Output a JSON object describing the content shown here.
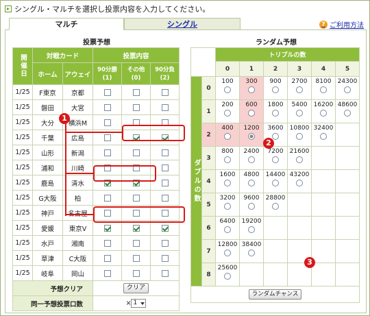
{
  "instruction": "シングル・マルチを選択し投票内容を入力してください。",
  "tabs": {
    "multi": "マルチ",
    "single": "シングル"
  },
  "help_link": "ご利用方法",
  "left": {
    "title": "投票予想",
    "headers": {
      "date": "開催日",
      "match": "対戦カード",
      "home": "ホーム",
      "away": "アウェイ",
      "vote": "投票内容",
      "o1": "90分勝",
      "o1b": "(1)",
      "o2": "その他",
      "o2b": "(0)",
      "o3": "90分負",
      "o3b": "(2)"
    },
    "rows": [
      {
        "date": "1/25",
        "home": "F東京",
        "away": "京都",
        "c": [
          false,
          false,
          false
        ]
      },
      {
        "date": "1/25",
        "home": "磐田",
        "away": "大宮",
        "c": [
          false,
          false,
          false
        ]
      },
      {
        "date": "1/25",
        "home": "大分",
        "away": "横浜M",
        "c": [
          false,
          false,
          false
        ]
      },
      {
        "date": "1/25",
        "home": "千葉",
        "away": "広島",
        "c": [
          false,
          true,
          true
        ]
      },
      {
        "date": "1/25",
        "home": "山形",
        "away": "新潟",
        "c": [
          false,
          false,
          false
        ]
      },
      {
        "date": "1/25",
        "home": "浦和",
        "away": "川崎",
        "c": [
          false,
          false,
          false
        ]
      },
      {
        "date": "1/25",
        "home": "鹿島",
        "away": "清水",
        "c": [
          true,
          true,
          false
        ]
      },
      {
        "date": "1/25",
        "home": "G大阪",
        "away": "柏",
        "c": [
          false,
          false,
          false
        ]
      },
      {
        "date": "1/25",
        "home": "神戸",
        "away": "名古屋",
        "c": [
          false,
          false,
          false
        ]
      },
      {
        "date": "1/25",
        "home": "愛媛",
        "away": "東京V",
        "c": [
          true,
          true,
          true
        ]
      },
      {
        "date": "1/25",
        "home": "水戸",
        "away": "湘南",
        "c": [
          false,
          false,
          false
        ]
      },
      {
        "date": "1/25",
        "home": "草津",
        "away": "C大阪",
        "c": [
          false,
          false,
          false
        ]
      },
      {
        "date": "1/25",
        "home": "岐阜",
        "away": "岡山",
        "c": [
          false,
          false,
          false
        ]
      }
    ],
    "clear_label": "予想クリア",
    "clear_button": "クリア",
    "multiplier_label": "同一予想投票口数",
    "multiplier_prefix": "×",
    "multiplier_value": "1"
  },
  "right": {
    "title": "ランダム予想",
    "triple_header": "トリプルの数",
    "double_header": "ダブルの数",
    "cols": [
      "0",
      "1",
      "2",
      "3",
      "4",
      "5"
    ],
    "rows": [
      {
        "label": "0",
        "cells": [
          "100",
          "300",
          "900",
          "2700",
          "8100",
          "24300"
        ]
      },
      {
        "label": "1",
        "cells": [
          "200",
          "600",
          "1800",
          "5400",
          "16200",
          "48600"
        ]
      },
      {
        "label": "2",
        "cells": [
          "400",
          "1200",
          "3600",
          "10800",
          "32400",
          ""
        ]
      },
      {
        "label": "3",
        "cells": [
          "800",
          "2400",
          "7200",
          "21600",
          "",
          ""
        ]
      },
      {
        "label": "4",
        "cells": [
          "1600",
          "4800",
          "14400",
          "43200",
          "",
          ""
        ]
      },
      {
        "label": "5",
        "cells": [
          "3200",
          "9600",
          "28800",
          "",
          "",
          ""
        ]
      },
      {
        "label": "6",
        "cells": [
          "6400",
          "19200",
          "",
          "",
          "",
          ""
        ]
      },
      {
        "label": "7",
        "cells": [
          "12800",
          "38400",
          "",
          "",
          "",
          ""
        ]
      },
      {
        "label": "8",
        "cells": [
          "25600",
          "",
          "",
          "",
          "",
          ""
        ]
      }
    ],
    "random_button": "ランダムチャンス"
  },
  "markers": [
    "1",
    "2",
    "3"
  ]
}
